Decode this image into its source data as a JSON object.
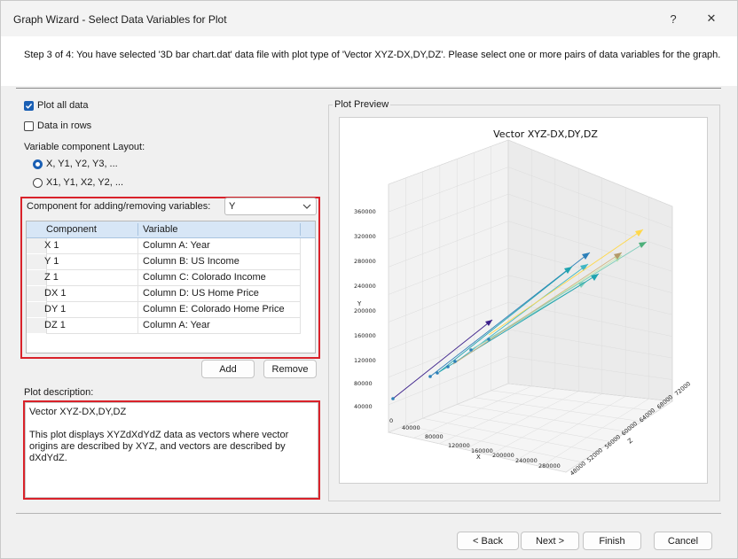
{
  "window": {
    "title": "Graph Wizard - Select Data Variables for Plot",
    "help_label": "?",
    "close_label": "✕"
  },
  "step": {
    "text": "Step 3 of 4:  You have selected '3D bar chart.dat' data file with plot type of 'Vector XYZ-DX,DY,DZ'. Please select one or more pairs of data variables for the graph."
  },
  "options": {
    "plot_all_data": {
      "label": "Plot all data",
      "checked": true
    },
    "data_in_rows": {
      "label": "Data in rows",
      "checked": false
    },
    "layout_label": "Variable component Layout:",
    "layout_option1": {
      "label": "X, Y1, Y2, Y3, ...",
      "checked": true
    },
    "layout_option2": {
      "label": "X1, Y1, X2, Y2, ...",
      "checked": false
    }
  },
  "component": {
    "label": "Component for adding/removing variables:",
    "selected": "Y"
  },
  "table": {
    "headers": [
      "Component",
      "Variable"
    ],
    "rows": [
      {
        "component": "X 1",
        "variable": "Column A: Year"
      },
      {
        "component": "Y 1",
        "variable": "Column B: US Income"
      },
      {
        "component": "Z 1",
        "variable": "Column C: Colorado Income"
      },
      {
        "component": "DX 1",
        "variable": "Column D: US Home Price"
      },
      {
        "component": "DY 1",
        "variable": "Column E: Colorado Home Price"
      },
      {
        "component": "DZ 1",
        "variable": "Column A: Year"
      }
    ]
  },
  "buttons": {
    "add": "Add",
    "remove": "Remove",
    "back": "< Back",
    "next": "Next >",
    "finish": "Finish",
    "cancel": "Cancel"
  },
  "description": {
    "label": "Plot description:",
    "line1": "Vector XYZ-DX,DY,DZ",
    "line2": "This plot displays XYZdXdYdZ data as vectors where vector origins are described by XYZ, and vectors are described by dXdYdZ."
  },
  "preview": {
    "label": "Plot Preview"
  },
  "chart_data": {
    "type": "scatter",
    "title": "Vector XYZ-DX,DY,DZ",
    "xlabel": "X",
    "ylabel": "Y",
    "zlabel": "Z",
    "x_ticks": [
      "0",
      "40000",
      "80000",
      "120000",
      "160000",
      "200000",
      "240000",
      "280000"
    ],
    "y_ticks": [
      "40000",
      "80000",
      "120000",
      "160000",
      "200000",
      "240000",
      "280000",
      "320000",
      "360000"
    ],
    "z_ticks": [
      "48000",
      "52000",
      "56000",
      "60000",
      "64000",
      "68000",
      "72000"
    ],
    "grid": true,
    "colors": [
      "#3b1f8a",
      "#2c7fb8",
      "#1fa3b0",
      "#41b6c4",
      "#7fcdbb",
      "#c7e9b4",
      "#ffd84a"
    ]
  }
}
